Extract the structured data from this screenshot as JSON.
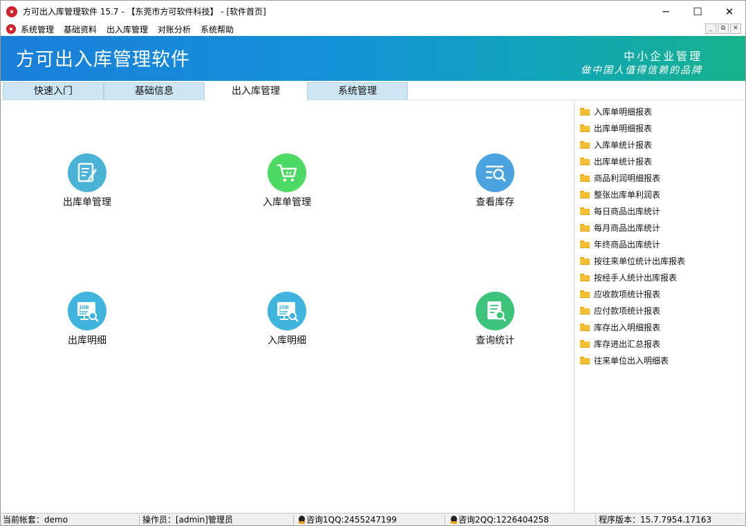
{
  "window": {
    "title": "方可出入库管理软件 15.7 - 【东莞市方可软件科技】 - [软件首页]",
    "controls": {
      "minimize": "─",
      "maximize": "☐",
      "close": "✕"
    }
  },
  "menu": {
    "items": [
      "系统管理",
      "基础资料",
      "出入库管理",
      "对账分析",
      "系统帮助"
    ],
    "mdi": {
      "minimize": "_",
      "restore": "⧉",
      "close": "✕"
    }
  },
  "banner": {
    "title": "方可出入库管理软件",
    "slogan_line1": "中小企业管理",
    "slogan_line2": "做中国人值得信赖的品牌"
  },
  "tabs": [
    {
      "label": "快速入门",
      "active": false
    },
    {
      "label": "基础信息",
      "active": false
    },
    {
      "label": "出入库管理",
      "active": true
    },
    {
      "label": "系统管理",
      "active": false
    }
  ],
  "functions": [
    {
      "label": "出库单管理",
      "icon": "edit-document-icon",
      "color": "#4ab3d6"
    },
    {
      "label": "入库单管理",
      "icon": "shopping-cart-icon",
      "color": "#4cd964"
    },
    {
      "label": "查看库存",
      "icon": "search-list-icon",
      "color": "#4aa3df"
    },
    {
      "label": "出库明细",
      "icon": "job-search-icon",
      "color": "#3fb4dd"
    },
    {
      "label": "入库明细",
      "icon": "job-search-icon",
      "color": "#3fb4dd"
    },
    {
      "label": "查询统计",
      "icon": "report-search-icon",
      "color": "#3cc47a"
    }
  ],
  "reports": [
    "入库单明细报表",
    "出库单明细报表",
    "入库单统计报表",
    "出库单统计报表",
    "商品利润明细报表",
    "整张出库单利润表",
    "每日商品出库统计",
    "每月商品出库统计",
    "年终商品出库统计",
    "按往来单位统计出库报表",
    "按经手人统计出库报表",
    "应收款项统计报表",
    "应付款项统计报表",
    "库存出入明细报表",
    "库存进出汇总报表",
    "往来单位出入明细表"
  ],
  "status": {
    "account": "当前帐套：demo",
    "operator": "操作员：[admin]管理员",
    "qq1": "咨询1QQ:2455247199",
    "qq2": "咨询2QQ:1226404258",
    "version": "程序版本：15.7.7954.17163"
  }
}
